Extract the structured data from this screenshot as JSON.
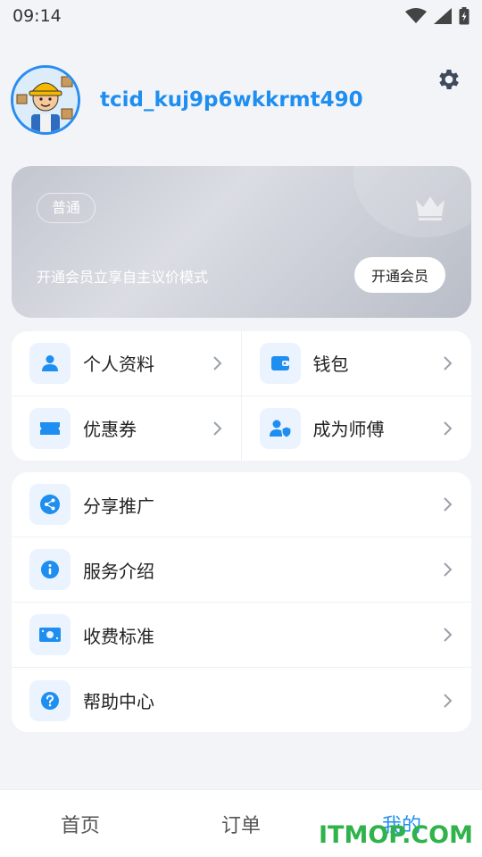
{
  "status_bar": {
    "time": "09:14",
    "icons": [
      "wifi-icon",
      "signal-icon",
      "battery-charging-icon"
    ]
  },
  "profile": {
    "username": "tcid_kuj9p6wkkrmt490",
    "avatar": "worker-avatar",
    "settings_icon": "gear-icon"
  },
  "member_card": {
    "level": "普通",
    "description": "开通会员立享自主议价模式",
    "button_label": "开通会员",
    "icon": "crown-icon"
  },
  "grid_menu": [
    {
      "label": "个人资料",
      "icon": "person-icon"
    },
    {
      "label": "钱包",
      "icon": "wallet-icon"
    },
    {
      "label": "优惠券",
      "icon": "ticket-icon"
    },
    {
      "label": "成为师傅",
      "icon": "user-shield-icon"
    }
  ],
  "list_menu": [
    {
      "label": "分享推广",
      "icon": "share-icon"
    },
    {
      "label": "服务介绍",
      "icon": "info-icon"
    },
    {
      "label": "收费标准",
      "icon": "money-icon"
    },
    {
      "label": "帮助中心",
      "icon": "question-icon"
    }
  ],
  "tabs": [
    {
      "label": "首页",
      "active": false
    },
    {
      "label": "订单",
      "active": false
    },
    {
      "label": "我的",
      "active": true
    }
  ],
  "watermark": "ITMOP.COM",
  "colors": {
    "accent": "#1e8ef0",
    "background": "#f3f4f8",
    "icon_bg": "#eaf3fe",
    "watermark": "#2fb34a"
  }
}
